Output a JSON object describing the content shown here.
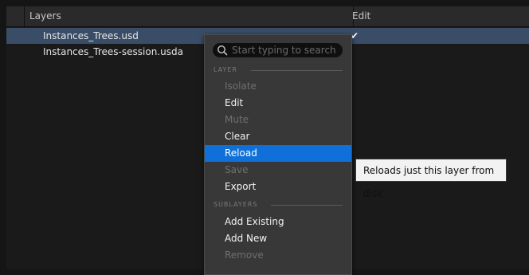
{
  "header": {
    "layers_label": "Layers",
    "edit_label": "Edit"
  },
  "layers": [
    {
      "name": "Instances_Trees.usd",
      "selected": true,
      "edit_checked": true,
      "check_glyph": "✔"
    },
    {
      "name": "Instances_Trees-session.usda",
      "selected": false,
      "edit_checked": false
    }
  ],
  "context_menu": {
    "search": {
      "placeholder": "Start typing to search",
      "value": "",
      "icon": "search-icon"
    },
    "sections": [
      {
        "label": "LAYER"
      },
      {
        "label": "SUBLAYERS"
      }
    ],
    "items": [
      {
        "label": "Isolate",
        "enabled": false
      },
      {
        "label": "Edit",
        "enabled": true
      },
      {
        "label": "Mute",
        "enabled": false
      },
      {
        "label": "Clear",
        "enabled": true
      },
      {
        "label": "Reload",
        "enabled": true,
        "highlighted": true
      },
      {
        "label": "Save",
        "enabled": false
      },
      {
        "label": "Export",
        "enabled": true
      },
      {
        "label": "Add Existing",
        "enabled": true
      },
      {
        "label": "Add New",
        "enabled": true
      },
      {
        "label": "Remove",
        "enabled": false
      }
    ]
  },
  "tooltip": {
    "text": "Reloads just this layer from disk"
  },
  "colors": {
    "selection_row": "#3a4d67",
    "menu_highlight": "#0e70d8",
    "menu_background": "#383838"
  }
}
